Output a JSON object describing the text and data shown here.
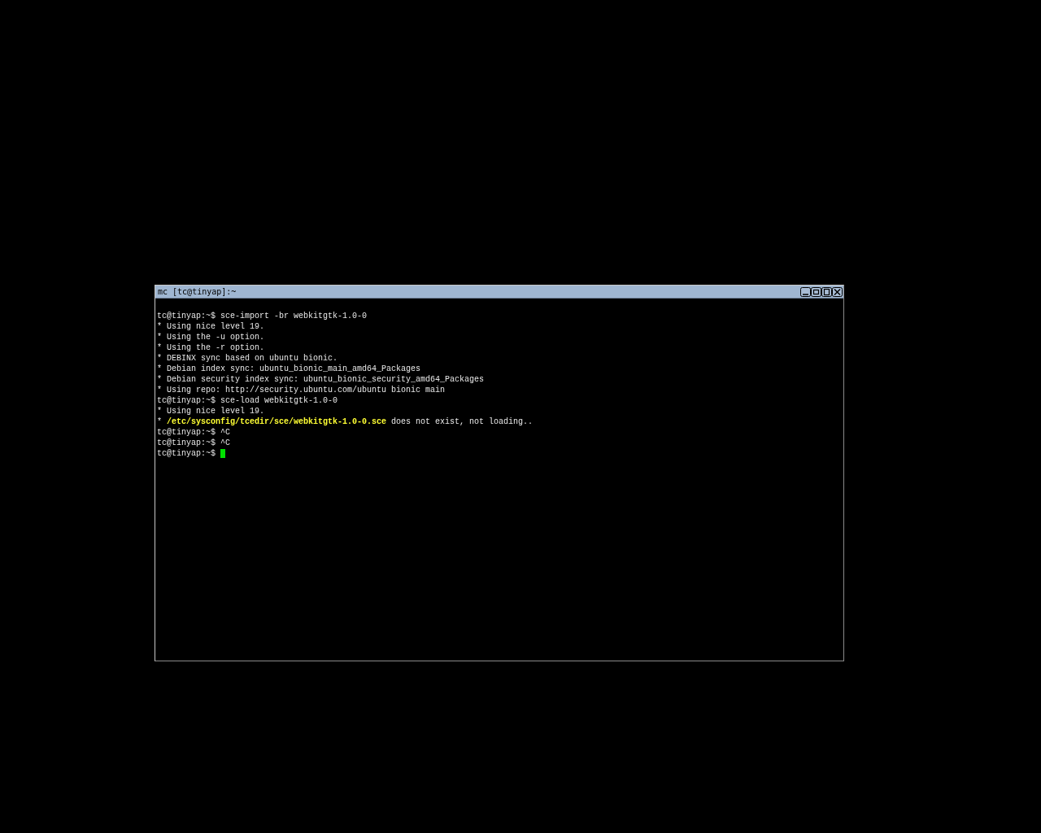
{
  "window": {
    "title": "mc [tc@tinyap]:~"
  },
  "terminal": {
    "lines": [
      {
        "text": "tc@tinyap:~$ sce-import -br webkitgtk-1.0-0",
        "cursor": false
      },
      {
        "text": "* Using nice level 19.",
        "cursor": false
      },
      {
        "text": "* Using the -u option.",
        "cursor": false
      },
      {
        "text": "* Using the -r option.",
        "cursor": false
      },
      {
        "text": "* DEBINX sync based on ubuntu bionic.",
        "cursor": false
      },
      {
        "text": "* Debian index sync: ubuntu_bionic_main_amd64_Packages",
        "cursor": false
      },
      {
        "text": "* Debian security index sync: ubuntu_bionic_security_amd64_Packages",
        "cursor": false
      },
      {
        "text": "* Using repo: http://security.ubuntu.com/ubuntu bionic main",
        "cursor": false
      },
      {
        "text": "tc@tinyap:~$ sce-load webkitgtk-1.0-0",
        "cursor": false
      },
      {
        "text": "* Using nice level 19.",
        "cursor": false
      },
      {
        "text": "* **/etc/sysconfig/tcedir/sce/webkitgtk-1.0-0.sce** does not exist, not loading..",
        "cursor": false
      },
      {
        "text": "tc@tinyap:~$ ^C",
        "cursor": false
      },
      {
        "text": "tc@tinyap:~$ ^C",
        "cursor": false
      },
      {
        "text": "tc@tinyap:~$ ",
        "cursor": true
      }
    ]
  }
}
